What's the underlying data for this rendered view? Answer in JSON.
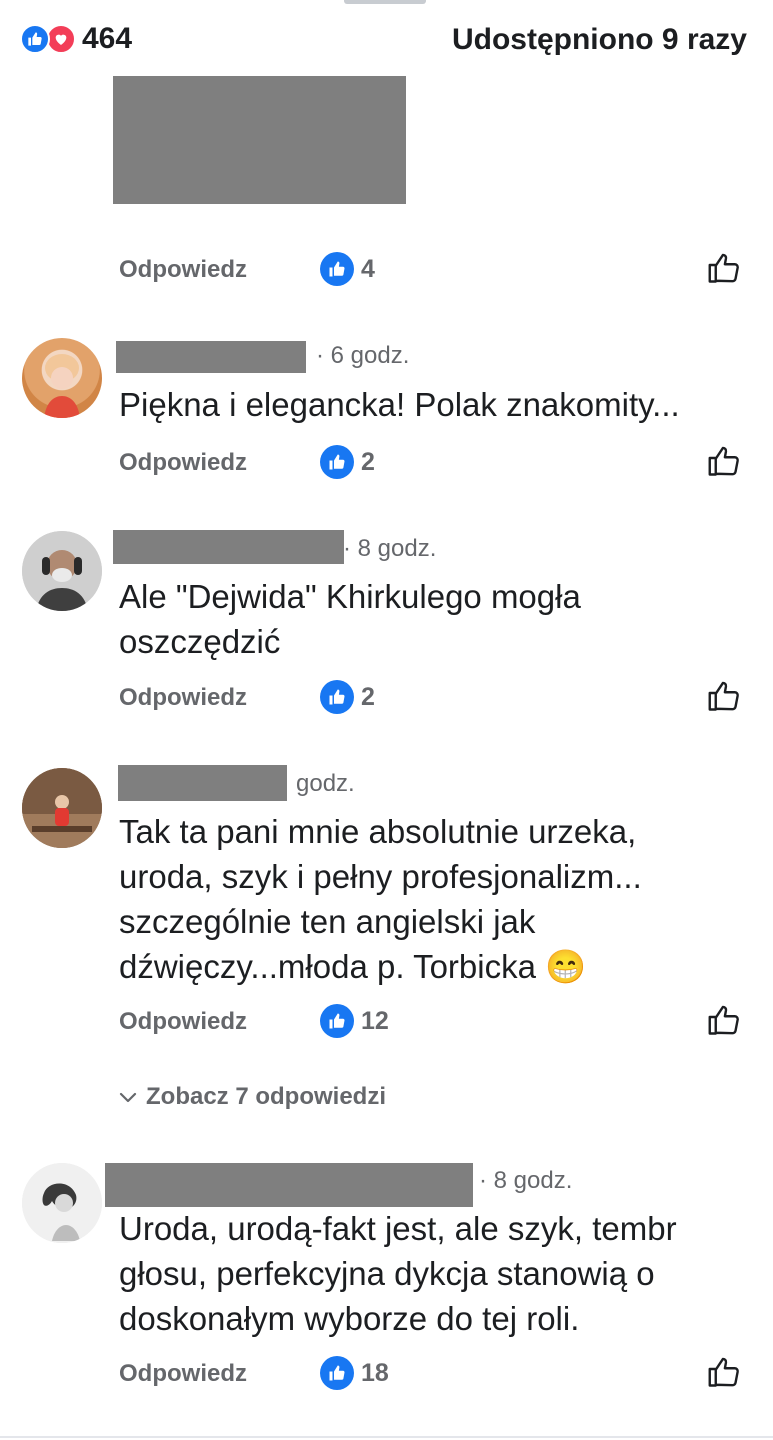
{
  "colors": {
    "accent": "#1877f2",
    "love": "#f33e58",
    "muted": "#65676b",
    "redaction": "#7f7f7f"
  },
  "post": {
    "reaction_icons": [
      "like-icon",
      "love-icon"
    ],
    "reactions_count": "464",
    "shares_label": "Udostępniono 9 razy"
  },
  "comments": [
    {
      "reply_label": "Odpowiedz",
      "likes": "4"
    },
    {
      "time": "· 6 godz.",
      "text": "Piękna i elegancka! Polak znakomity...",
      "reply_label": "Odpowiedz",
      "likes": "2"
    },
    {
      "time": "· 8 godz.",
      "text_lines": [
        "Ale \"Dejwida\" Khirkulego mogła",
        "oszczędzić"
      ],
      "reply_label": "Odpowiedz",
      "likes": "2"
    },
    {
      "time": "godz.",
      "text_lines": [
        "Tak ta pani mnie absolutnie urzeka,",
        "uroda, szyk i pełny profesjonalizm...",
        "szczególnie ten angielski jak",
        "dźwięczy...młoda p. Torbicka"
      ],
      "emoji": "😁",
      "reply_label": "Odpowiedz",
      "likes": "12",
      "more_replies": "Zobacz 7 odpowiedzi"
    },
    {
      "time": "· 8 godz.",
      "text_lines": [
        "Uroda, urodą-fakt jest, ale szyk, tembr",
        "głosu, perfekcyjna dykcja stanowią o",
        "doskonałym wyborze do tej roli."
      ],
      "reply_label": "Odpowiedz",
      "likes": "18"
    }
  ]
}
